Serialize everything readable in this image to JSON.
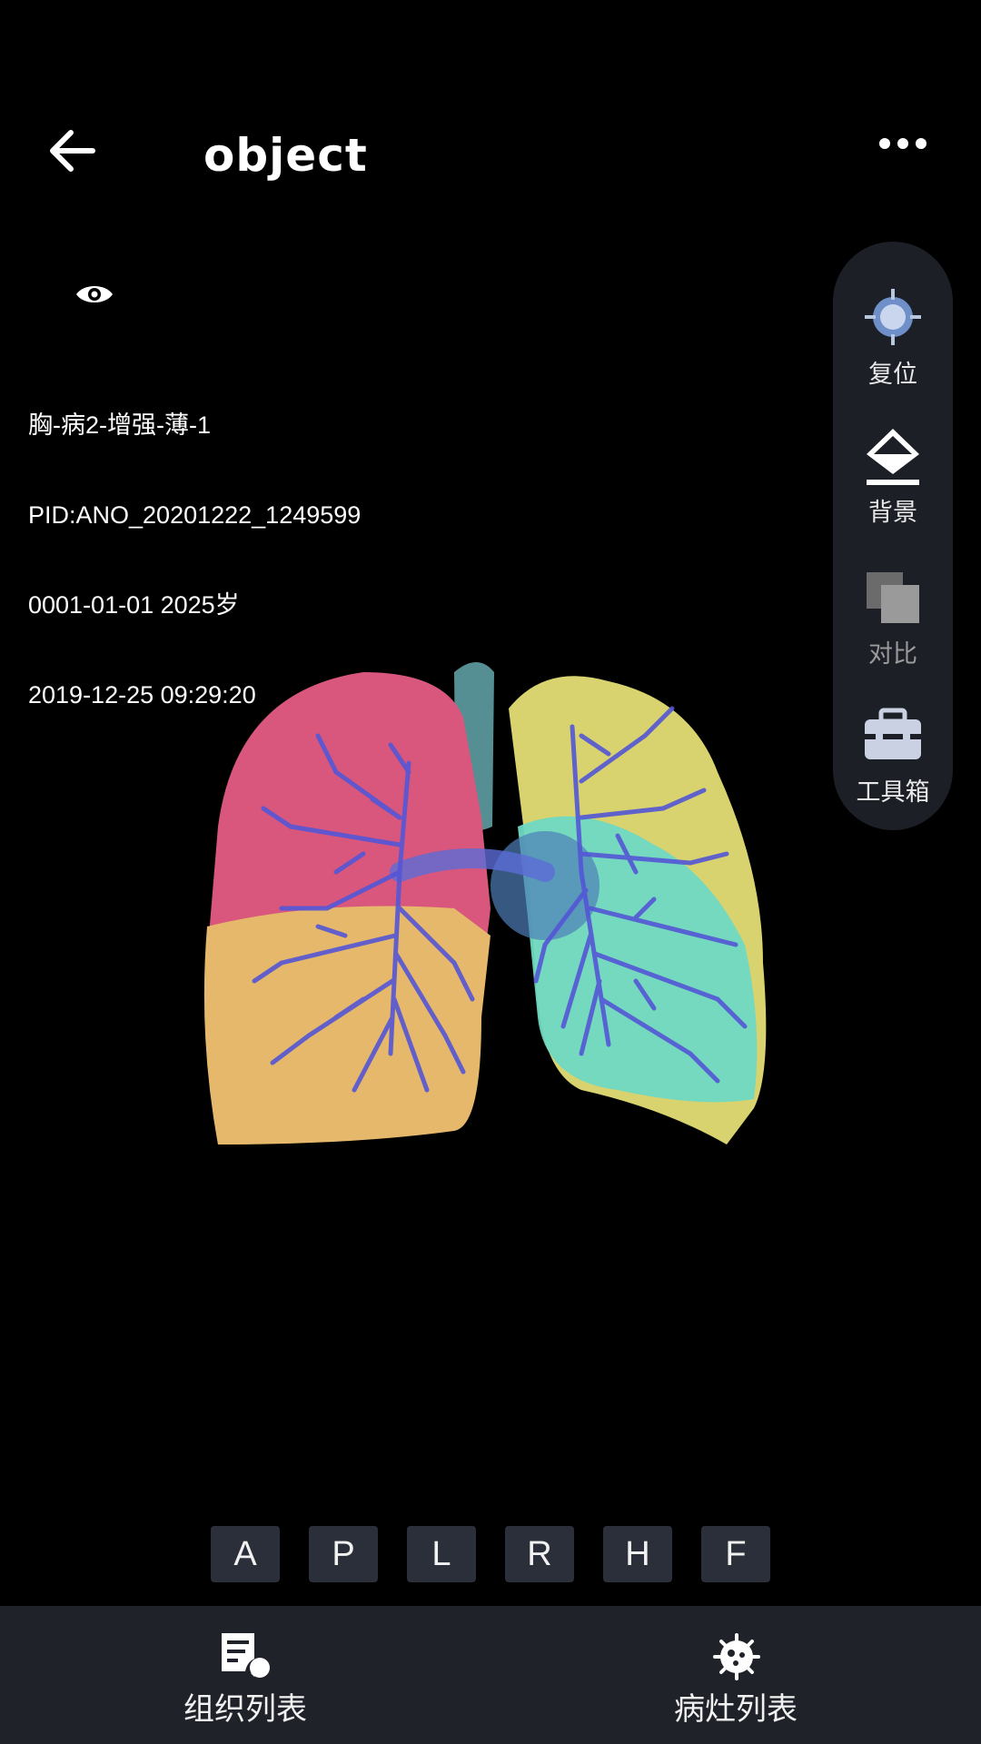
{
  "header": {
    "title": "object"
  },
  "info": {
    "lines": [
      "胸-病2-增强-薄-1",
      "PID:ANO_20201222_1249599",
      "0001-01-01 2025岁",
      "2019-12-25 09:29:20"
    ]
  },
  "side_panel": {
    "reset": "复位",
    "background": "背景",
    "compare": "对比",
    "toolbox": "工具箱"
  },
  "views": [
    "A",
    "P",
    "L",
    "R",
    "H",
    "F"
  ],
  "bottom_nav": {
    "tissue_list": "组织列表",
    "lesion_list": "病灶列表"
  },
  "colors": {
    "panel_bg": "#1c1f26",
    "bottom_bg": "#1f2229",
    "view_btn_bg": "#2b2f39"
  }
}
